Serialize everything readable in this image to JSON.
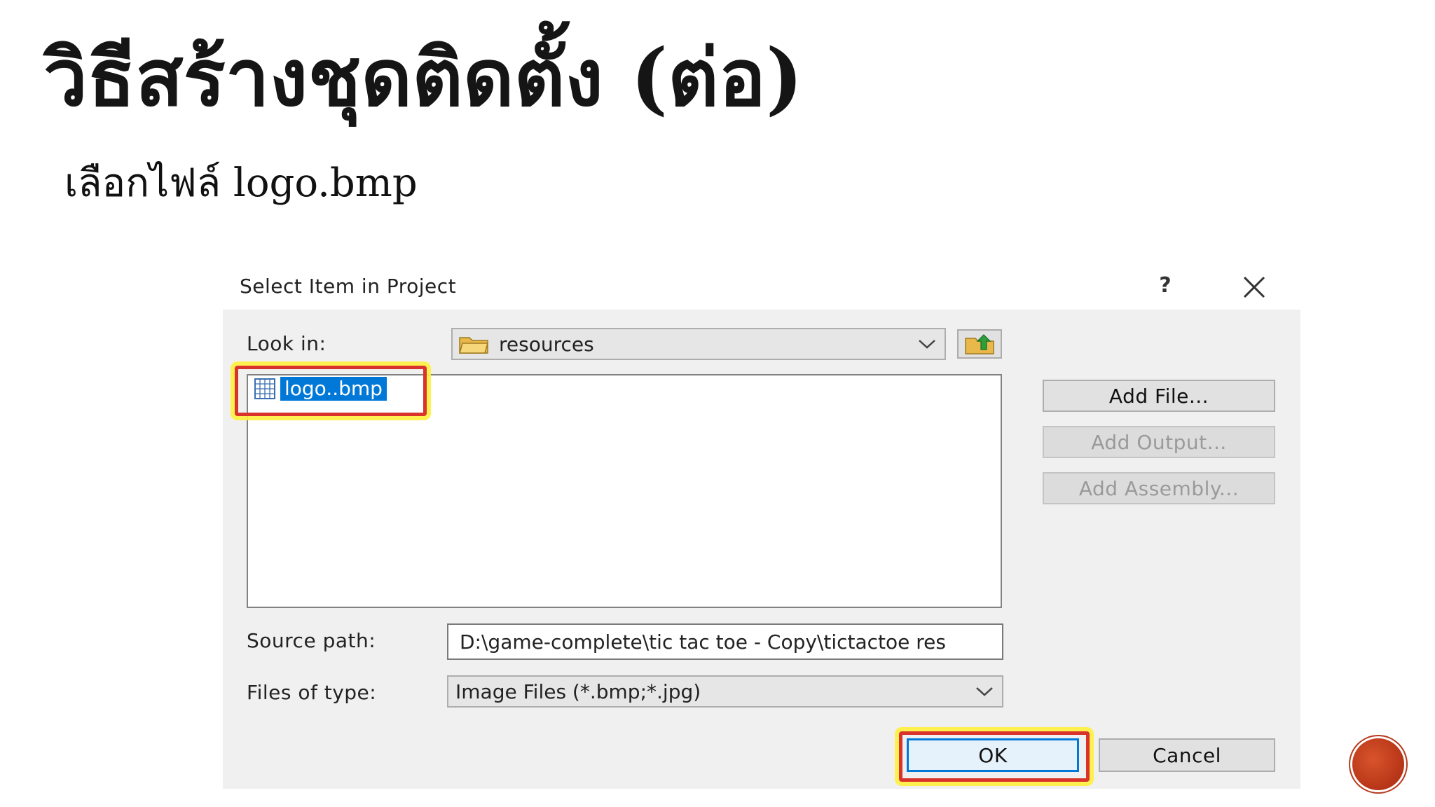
{
  "slide": {
    "title": "วิธีสร้างชุดติดตั้ง (ต่อ)",
    "subtitle": "เลือกไฟล์ logo.bmp"
  },
  "dialog": {
    "caption": "Select Item in Project",
    "help_label": "?",
    "look_in": {
      "label": "Look in:",
      "value": "resources"
    },
    "file_list": {
      "items": [
        {
          "name": "logo..bmp",
          "selected": true
        }
      ]
    },
    "side_buttons": {
      "add_file": "Add File...",
      "add_output": "Add Output...",
      "add_assembly": "Add Assembly..."
    },
    "source_path": {
      "label": "Source path:",
      "value": "D:\\game-complete\\tic tac toe - Copy\\tictactoe res"
    },
    "files_of_type": {
      "label": "Files of type:",
      "value": "Image Files (*.bmp;*.jpg)"
    },
    "ok_label": "OK",
    "cancel_label": "Cancel"
  },
  "colors": {
    "selection": "#0078d7",
    "highlight_border": "#d9342b",
    "highlight_glow": "#fff03c",
    "dialog_bg": "#f0f0f0"
  },
  "icons": {
    "folder": "folder-icon",
    "up_folder": "up-folder-icon",
    "bitmap_file": "bitmap-file-icon",
    "close": "close-icon",
    "chevron": "chevron-down-icon"
  }
}
